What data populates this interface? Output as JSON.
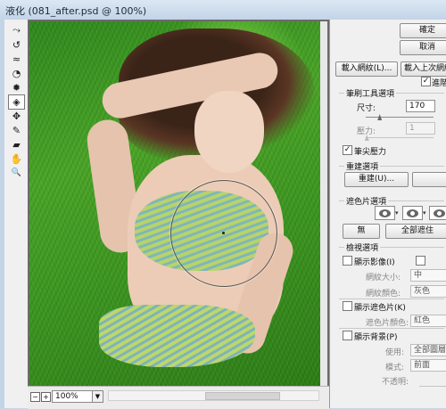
{
  "window": {
    "title": "液化 (081_after.psd @ 100%)"
  },
  "toolbox": {
    "tools": [
      {
        "name": "forward-warp-tool",
        "glyph": "⤳"
      },
      {
        "name": "reconstruct-tool",
        "glyph": "↺"
      },
      {
        "name": "smooth-tool",
        "glyph": "≈"
      },
      {
        "name": "twirl-clockwise-tool",
        "glyph": "◔"
      },
      {
        "name": "pucker-tool",
        "glyph": "✹"
      },
      {
        "name": "bloat-tool",
        "glyph": "◈"
      },
      {
        "name": "push-left-tool",
        "glyph": "✥"
      },
      {
        "name": "freeze-mask-tool",
        "glyph": "✎"
      },
      {
        "name": "thaw-mask-tool",
        "glyph": "▰"
      },
      {
        "name": "hand-tool",
        "glyph": "✋"
      },
      {
        "name": "zoom-tool",
        "glyph": "🔍"
      }
    ],
    "active_index": 5
  },
  "canvas": {
    "zoom": "100%"
  },
  "panel": {
    "ok_button": "確定",
    "cancel_button": "取消",
    "load_mesh_button": "載入網紋(L)...",
    "load_last_mesh_button": "載入上次網紋",
    "advanced_mode_label": "進階模式",
    "advanced_mode_checked": true,
    "brush_tool_options": {
      "heading": "筆刷工具選項",
      "size_label": "尺寸:",
      "size_value": "170",
      "size_level": 0.2,
      "pressure_label": "壓力:",
      "pressure_value": "1",
      "pressure_level": 0.01,
      "stylus_pressure_label": "筆尖壓力",
      "stylus_pressure_checked": true
    },
    "reconstruct_options": {
      "heading": "重建選項",
      "reconstruct_button": "重建(U)..."
    },
    "mask_options": {
      "heading": "遮色片選項",
      "none_button": "無",
      "mask_all_button": "全部遮住"
    },
    "view_options": {
      "heading": "檢視選項",
      "show_image_label": "顯示影像(I)",
      "show_image_checked": false,
      "mesh_size_label": "網紋大小:",
      "mesh_size_value": "中",
      "mesh_color_label": "網紋顏色:",
      "mesh_color_value": "灰色",
      "show_mask_label": "顯示遮色片(K)",
      "show_mask_checked": false,
      "mask_color_label": "遮色片顏色:",
      "mask_color_value": "紅色",
      "show_backdrop_label": "顯示背景(P)",
      "show_backdrop_checked": false,
      "use_label": "使用:",
      "use_value": "全部圖層",
      "mode_label": "模式:",
      "mode_value": "前面",
      "opacity_label": "不透明:"
    }
  }
}
